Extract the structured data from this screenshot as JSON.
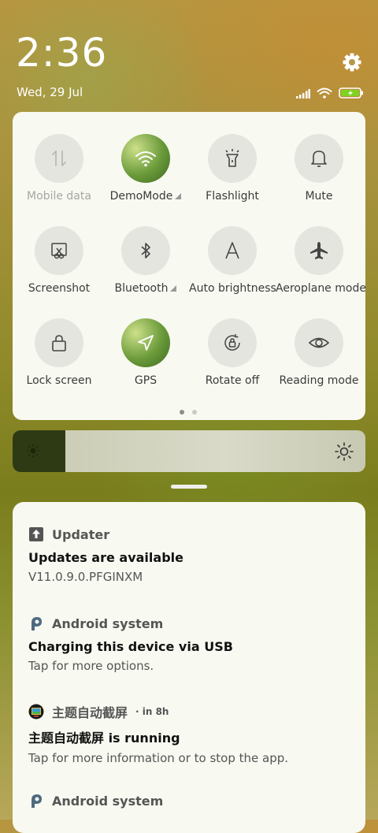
{
  "status_bar": {
    "time": "2:36",
    "date": "Wed, 29 Jul",
    "icons": [
      "signal-icon",
      "wifi-icon",
      "battery-charging-icon"
    ]
  },
  "quick_settings": {
    "tiles": [
      {
        "label": "Mobile data",
        "icon": "mobile-data-icon",
        "active": false,
        "disabled": true
      },
      {
        "label": "DemoMode",
        "icon": "wifi-icon",
        "active": true,
        "expandable": true
      },
      {
        "label": "Flashlight",
        "icon": "flashlight-icon",
        "active": false
      },
      {
        "label": "Mute",
        "icon": "bell-icon",
        "active": false
      },
      {
        "label": "Screenshot",
        "icon": "screenshot-icon",
        "active": false
      },
      {
        "label": "Bluetooth",
        "icon": "bluetooth-icon",
        "active": false,
        "expandable": true
      },
      {
        "label": "Auto brightness",
        "icon": "auto-brightness-icon",
        "active": false
      },
      {
        "label": "Aeroplane mode",
        "icon": "airplane-icon",
        "active": false
      },
      {
        "label": "Lock screen",
        "icon": "lock-icon",
        "active": false
      },
      {
        "label": "GPS",
        "icon": "gps-icon",
        "active": true
      },
      {
        "label": "Rotate off",
        "icon": "rotate-lock-icon",
        "active": false
      },
      {
        "label": "Reading mode",
        "icon": "eye-icon",
        "active": false
      }
    ],
    "page_indicator": {
      "pages": 2,
      "current": 1
    }
  },
  "brightness": {
    "level": 0.15
  },
  "notifications": [
    {
      "app": "Updater",
      "icon": "updater-icon",
      "meta": "",
      "title": "Updates are available",
      "body": "V11.0.9.0.PFGINXM"
    },
    {
      "app": "Android system",
      "icon": "android-system-icon",
      "meta": "",
      "title": "Charging this device via USB",
      "body": "Tap for more options."
    },
    {
      "app": "主题自动截屏",
      "icon": "theme-screenshot-app-icon",
      "meta": "· in 8h",
      "title": "主题自动截屏 is running",
      "body": "Tap for more information or to stop the app."
    },
    {
      "app": "Android system",
      "icon": "android-system-icon",
      "meta": "",
      "title": "",
      "body": ""
    }
  ],
  "colors": {
    "active_tile": "#6a9a3a",
    "panel_bg": "#f8f9f1",
    "tile_bg": "#e4e5df"
  }
}
